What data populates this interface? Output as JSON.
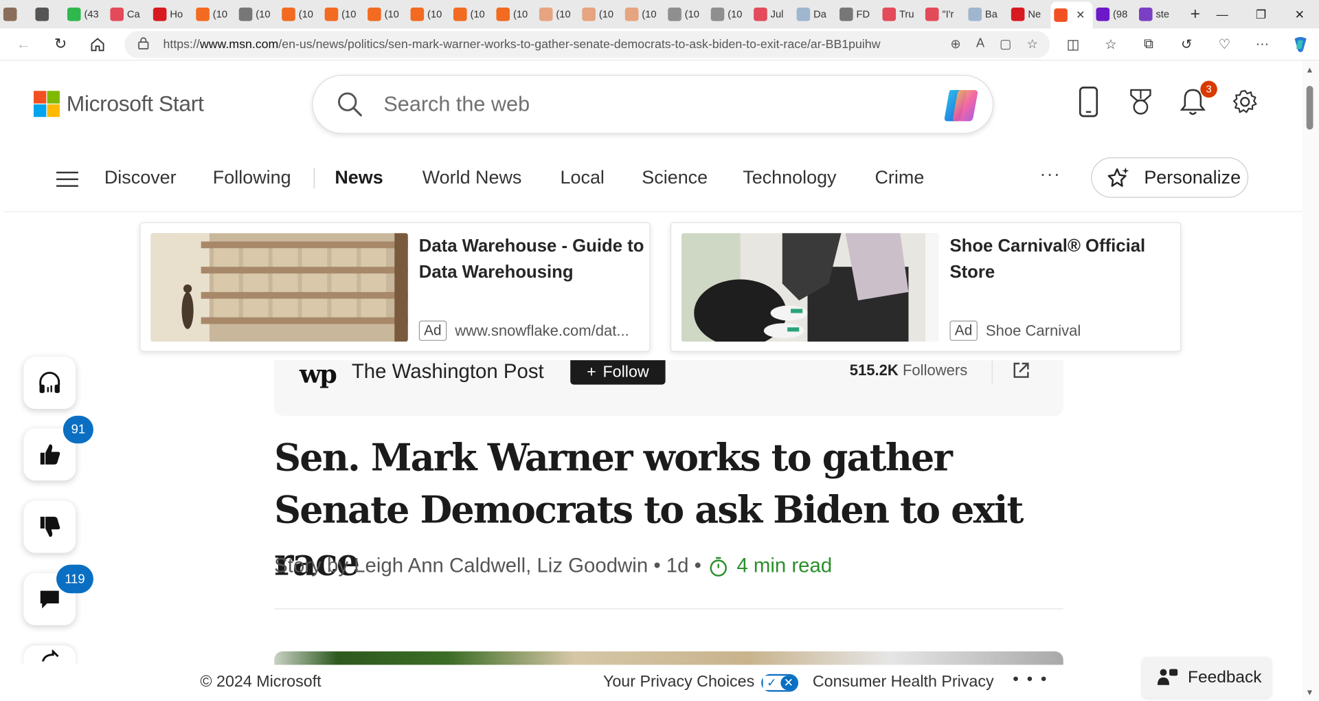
{
  "browser": {
    "tabs": [
      {
        "label": "",
        "color": "#8a6e5a"
      },
      {
        "label": "",
        "color": "#555555"
      },
      {
        "label": "(43",
        "color": "#2fb84d"
      },
      {
        "label": "Ca",
        "color": "#e34b5a"
      },
      {
        "label": "Ho",
        "color": "#d71920"
      },
      {
        "label": "(10",
        "color": "#f26b21"
      },
      {
        "label": "(10",
        "color": "#777777"
      },
      {
        "label": "(10",
        "color": "#f26b21"
      },
      {
        "label": "(10",
        "color": "#f26b21"
      },
      {
        "label": "(10",
        "color": "#f26b21"
      },
      {
        "label": "(10",
        "color": "#f26b21"
      },
      {
        "label": "(10",
        "color": "#f26b21"
      },
      {
        "label": "(10",
        "color": "#f26b21"
      },
      {
        "label": "(10",
        "color": "#e6a480"
      },
      {
        "label": "(10",
        "color": "#e6a480"
      },
      {
        "label": "(10",
        "color": "#e6a480"
      },
      {
        "label": "(10",
        "color": "#8f8f8f"
      },
      {
        "label": "(10",
        "color": "#8f8f8f"
      },
      {
        "label": "Jul",
        "color": "#e34b5a"
      },
      {
        "label": "Da",
        "color": "#9fb6cf"
      },
      {
        "label": "FD",
        "color": "#777777"
      },
      {
        "label": "Tru",
        "color": "#e34b5a"
      },
      {
        "label": "\"I'r",
        "color": "#e34b5a"
      },
      {
        "label": "Ba",
        "color": "#9fb6cf"
      },
      {
        "label": "Ne",
        "color": "#d71920"
      },
      {
        "label": "",
        "color": "#f25022"
      },
      {
        "label": "(98",
        "color": "#6c19c9"
      },
      {
        "label": "ste",
        "color": "#7b3fc4"
      }
    ],
    "active_tab_index": 25,
    "url_prefix": "https://",
    "url_host": "www.msn.com",
    "url_path": "/en-us/news/politics/sen-mark-warner-works-to-gather-senate-democrats-to-ask-biden-to-exit-race/ar-BB1puihw"
  },
  "header": {
    "logo_text": "Microsoft Start",
    "search_placeholder": "Search the web",
    "notifications_count": "3"
  },
  "nav": {
    "items": [
      "Discover",
      "Following",
      "News",
      "World News",
      "Local",
      "Science",
      "Technology",
      "Crime"
    ],
    "active": "News",
    "more_label": "···",
    "personalize_label": "Personalize"
  },
  "ads": [
    {
      "title": "Data Warehouse - Guide to Data Warehousing",
      "tag": "Ad",
      "source": "www.snowflake.com/dat..."
    },
    {
      "title": "Shoe Carnival® Official Store",
      "tag": "Ad",
      "source": "Shoe Carnival"
    }
  ],
  "article": {
    "publisher_logo": "wp",
    "publisher": "The Washington Post",
    "follow_label": "Follow",
    "followers_count": "515.2K",
    "followers_label": "Followers",
    "headline": "Sen. Mark Warner works to gather Senate Democrats to ask Biden to exit race",
    "byline": "Story by Leigh Ann Caldwell, Liz Goodwin • 1d •",
    "read_time": "4 min read"
  },
  "rail": {
    "likes": "91",
    "comments": "119"
  },
  "footer": {
    "copyright": "© 2024 Microsoft",
    "privacy": "Your Privacy Choices",
    "consumer_health": "Consumer Health Privacy",
    "more": "• • •",
    "feedback": "Feedback"
  },
  "colors": {
    "accent_blue": "#0a6fc2",
    "notification_red": "#d83b01",
    "read_time_green": "#2b8f2b"
  }
}
